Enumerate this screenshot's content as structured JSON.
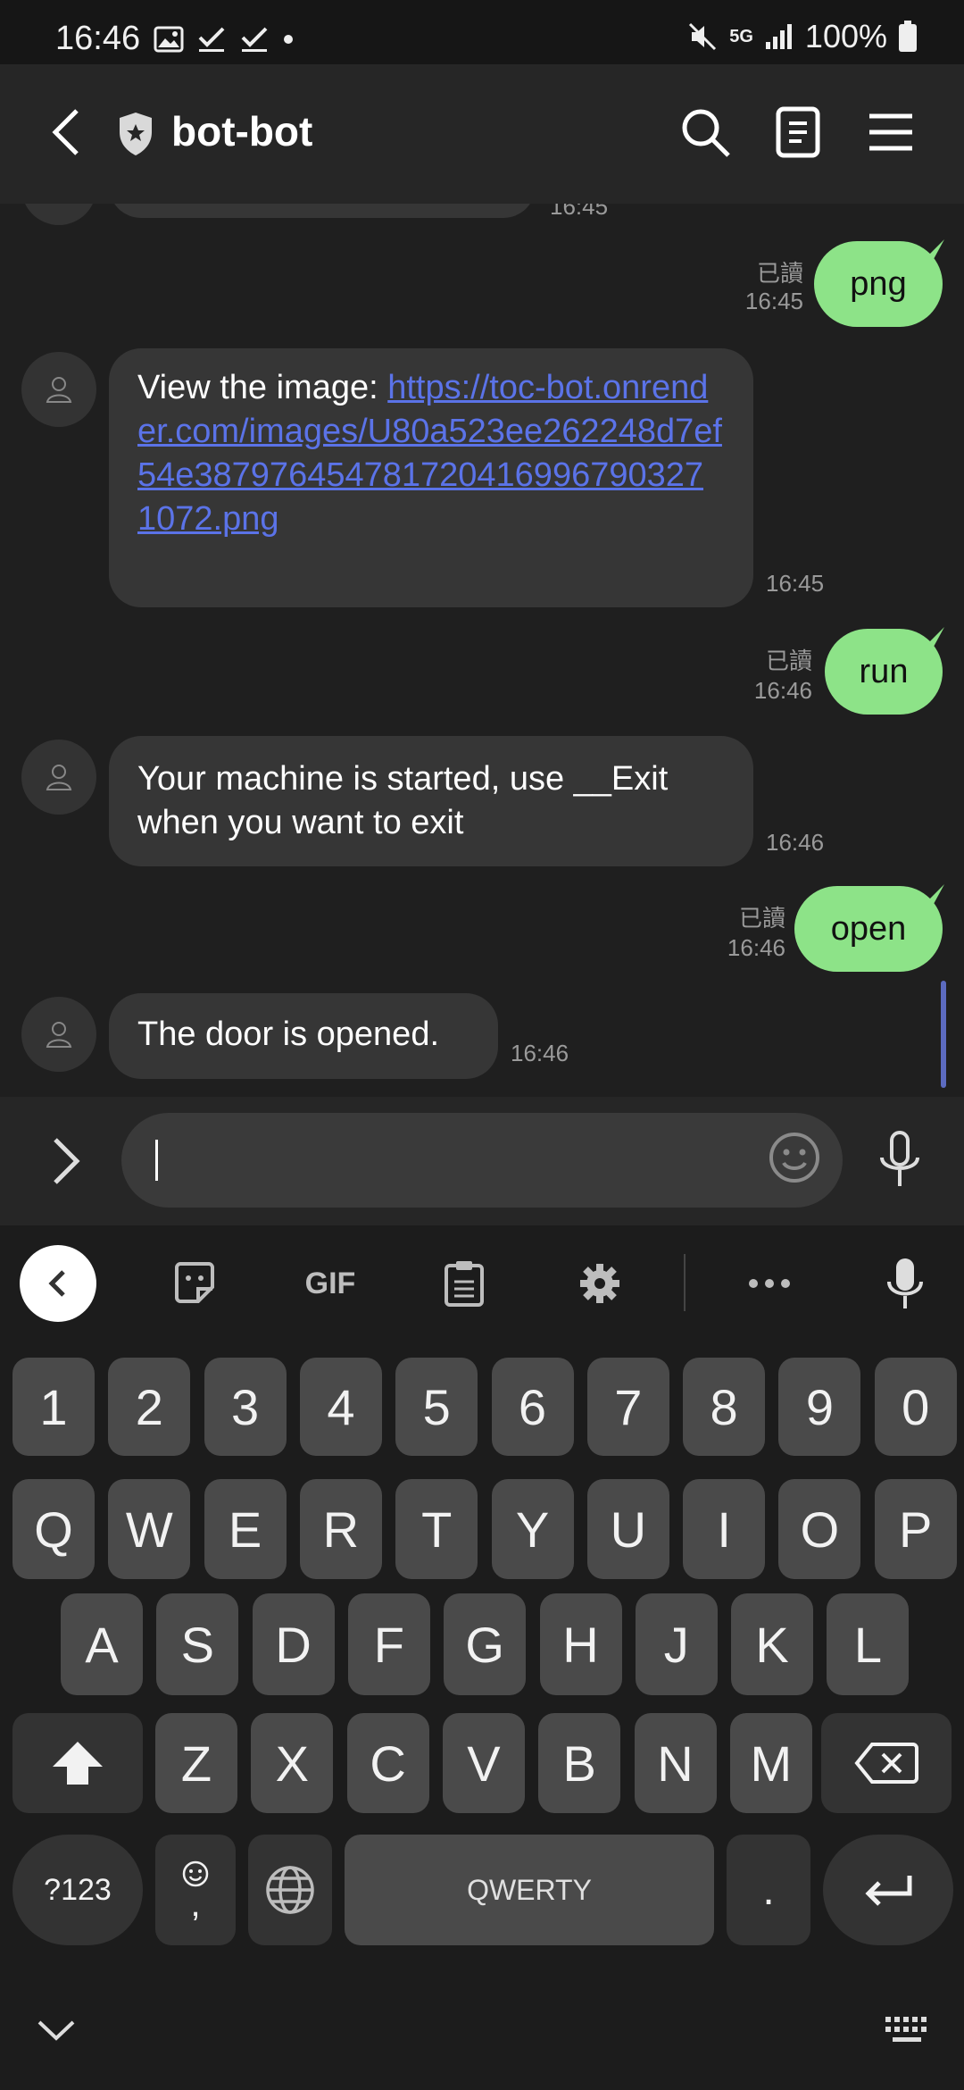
{
  "status_bar": {
    "time": "16:46",
    "network": "5G",
    "battery": "100%"
  },
  "header": {
    "title": "bot-bot"
  },
  "messages": [
    {
      "dir": "out",
      "text": "png",
      "read": "已讀",
      "time": "16:45"
    },
    {
      "dir": "in",
      "prefix": "View the image: ",
      "link": "https://toc-bot.onrender.com/images/U80a523ee262248d7ef54e387976454781720416996790327 1072.png",
      "time": "16:45"
    },
    {
      "dir": "out",
      "text": "run",
      "read": "已讀",
      "time": "16:46"
    },
    {
      "dir": "in",
      "text": "Your machine is started, use __Exit when you want to exit",
      "time": "16:46"
    },
    {
      "dir": "out",
      "text": "open",
      "read": "已讀",
      "time": "16:46"
    },
    {
      "dir": "in",
      "text": "The door is opened.",
      "time": "16:46"
    }
  ],
  "partial_time": "16:45",
  "input": {
    "placeholder": ""
  },
  "keyboard": {
    "gif_label": "GIF",
    "row_numbers": [
      "1",
      "2",
      "3",
      "4",
      "5",
      "6",
      "7",
      "8",
      "9",
      "0"
    ],
    "row1": [
      "Q",
      "W",
      "E",
      "R",
      "T",
      "Y",
      "U",
      "I",
      "O",
      "P"
    ],
    "row2": [
      "A",
      "S",
      "D",
      "F",
      "G",
      "H",
      "J",
      "K",
      "L"
    ],
    "row3": [
      "Z",
      "X",
      "C",
      "V",
      "B",
      "N",
      "M"
    ],
    "symbols_label": "?123",
    "comma_label": ",",
    "space_label": "QWERTY",
    "period_label": "."
  },
  "colors": {
    "outgoing": "#8de388",
    "incoming": "#363636",
    "link": "#5b73e8"
  }
}
